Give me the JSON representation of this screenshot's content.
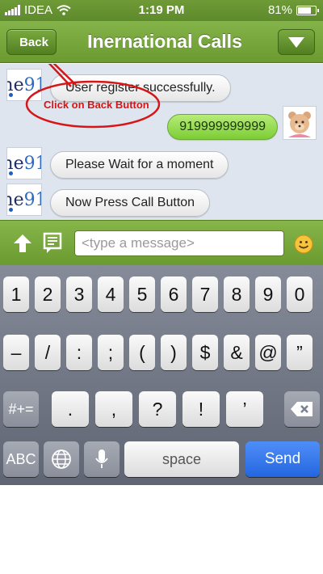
{
  "status_bar": {
    "carrier": "IDEA",
    "time": "1:19 PM",
    "battery_pct": "81%",
    "battery_level": 0.81
  },
  "nav": {
    "back_label": "Back",
    "title": "Inernational Calls",
    "menu_icon": "chevron-down-icon"
  },
  "chat": {
    "logo_text": "ne",
    "logo_number": "91",
    "messages": [
      {
        "from": "service",
        "text": "User register successfully."
      },
      {
        "from": "user",
        "text": "919999999999"
      },
      {
        "from": "service",
        "text": "Please Wait for a moment"
      },
      {
        "from": "service",
        "text": "Now Press Call Button"
      }
    ],
    "annotation": "Click on Back Button"
  },
  "input_bar": {
    "placeholder": "<type a message>",
    "left_icons": [
      "arrow-up-icon",
      "message-icon"
    ],
    "right_icon": "smiley-icon"
  },
  "keyboard": {
    "row1": [
      "1",
      "2",
      "3",
      "4",
      "5",
      "6",
      "7",
      "8",
      "9",
      "0"
    ],
    "row2": [
      "–",
      "/",
      ":",
      ";",
      "(",
      ")",
      "$",
      "&",
      "@",
      "”"
    ],
    "row3_mode": "#+=",
    "row3": [
      ".",
      ",",
      "?",
      "!",
      "’"
    ],
    "backspace_icon": "backspace-icon",
    "abc_label": "ABC",
    "globe_icon": "globe-icon",
    "mic_icon": "microphone-icon",
    "space_label": "space",
    "send_label": "Send"
  },
  "colors": {
    "accent_green": "#6a9a30",
    "annotation_red": "#d61616",
    "send_blue": "#2466e0"
  }
}
